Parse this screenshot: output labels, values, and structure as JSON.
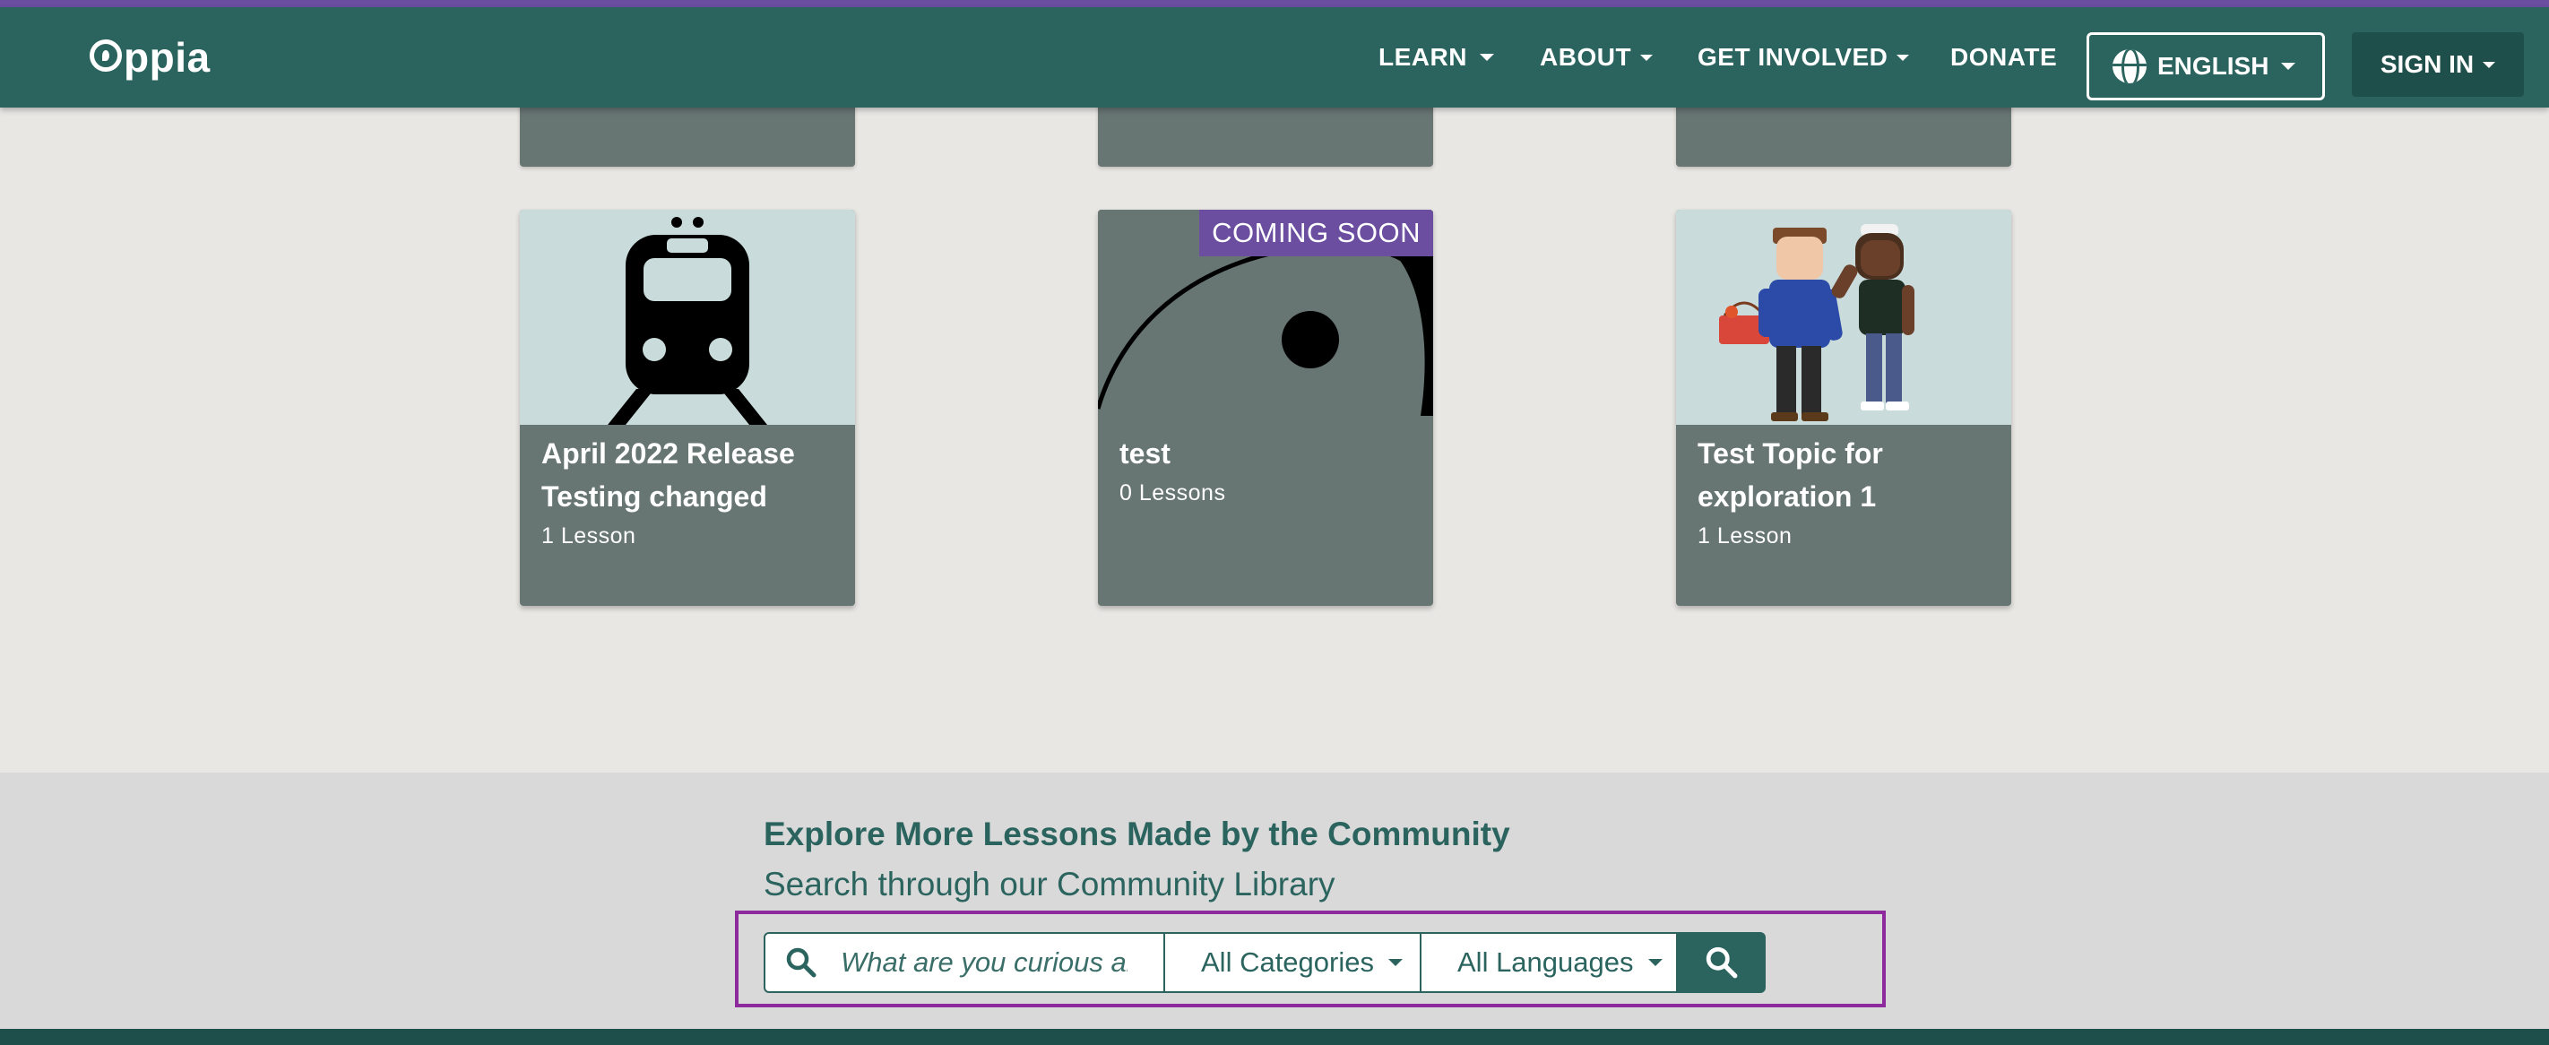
{
  "navbar": {
    "logo_text": "ppia",
    "items": [
      {
        "label": "LEARN"
      },
      {
        "label": "ABOUT"
      },
      {
        "label": "GET INVOLVED"
      },
      {
        "label": "DONATE"
      }
    ],
    "language_label": "ENGLISH",
    "signin_label": "SIGN IN"
  },
  "cards": [
    {
      "title": "April 2022 Release Testing changed",
      "subtitle": "1 Lesson",
      "thumbnail_icon": "train-icon"
    },
    {
      "title": "test",
      "subtitle": "0 Lessons",
      "badge": "COMING SOON",
      "thumbnail_icon": "abstract-thumbnail"
    },
    {
      "title": "Test Topic for exploration 1",
      "subtitle": "1 Lesson",
      "thumbnail_icon": "two-people-illustration"
    }
  ],
  "explore": {
    "title": "Explore More Lessons Made by the Community",
    "subtitle": "Search through our Community Library",
    "search_placeholder": "What are you curious about?",
    "categories_label": "All Categories",
    "languages_label": "All Languages"
  },
  "colors": {
    "nav_bg": "#2b645e",
    "accent_purple": "#6b4ea0",
    "card_bg": "#677573",
    "thumb_bg": "#c9dcdb",
    "highlight": "#8e2a9e"
  }
}
